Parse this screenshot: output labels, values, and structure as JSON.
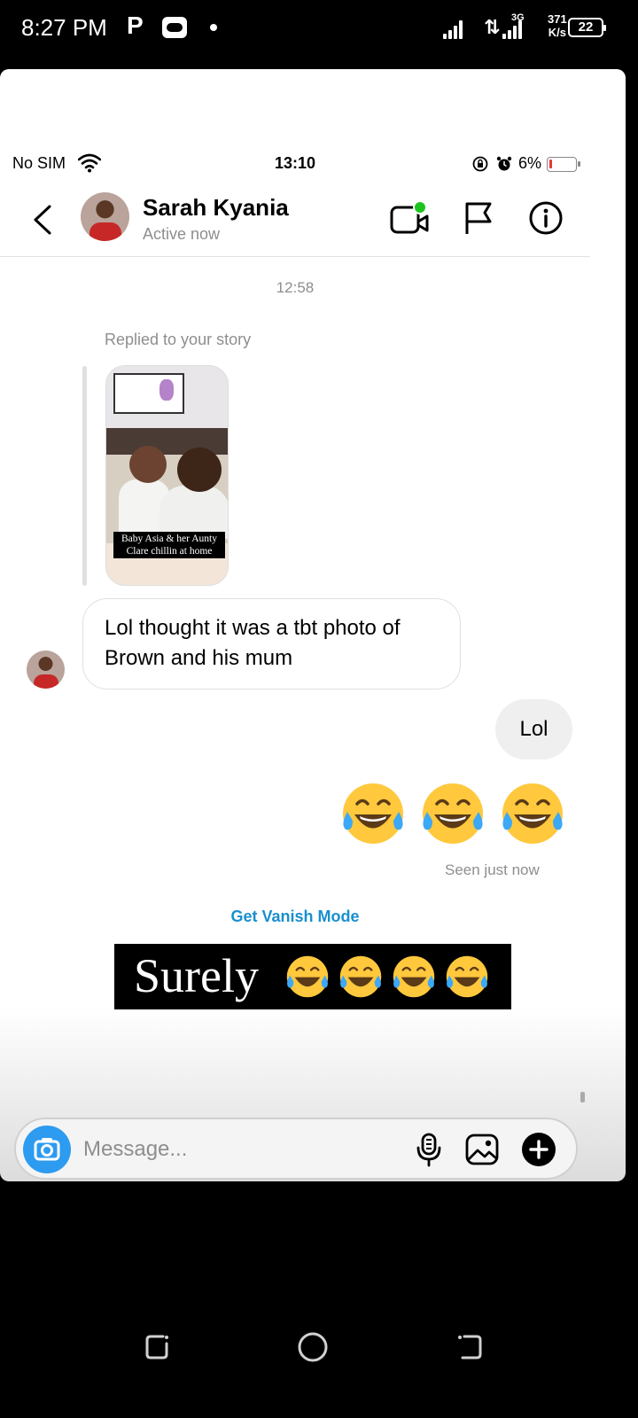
{
  "android_status": {
    "time": "8:27 PM",
    "app_badge_letter": "P",
    "network_type": "3G",
    "speed_value": "371",
    "speed_unit": "K/s",
    "battery": "22"
  },
  "ios_status": {
    "carrier": "No SIM",
    "time": "13:10",
    "battery_percent": "6%"
  },
  "header": {
    "contact_name": "Sarah Kyania",
    "contact_status": "Active now"
  },
  "thread": {
    "timestamp": "12:58",
    "reply_caption": "Replied to your story",
    "story_caption": "Baby Asia & her Aunty Clare chillin at home",
    "incoming_message": "Lol thought it was a tbt photo of Brown and his mum",
    "outgoing_message": "Lol",
    "outgoing_emojis": [
      "laugh-cry-emoji",
      "laugh-cry-emoji",
      "laugh-cry-emoji"
    ],
    "seen_status": "Seen just now",
    "vanish_mode_link": "Get Vanish Mode"
  },
  "overlay": {
    "caption": "Surely",
    "emojis": [
      "laugh-cry-emoji",
      "laugh-cry-emoji",
      "laugh-cry-emoji",
      "laugh-cry-emoji"
    ]
  },
  "composer": {
    "placeholder": "Message...",
    "value": ""
  },
  "colors": {
    "online_dot": "#1dc41d",
    "link_blue": "#1a8fcf",
    "camera_blue": "#2d9bf0",
    "battery_low": "#e53935"
  },
  "icons": [
    "back-icon",
    "video-call-icon",
    "flag-icon",
    "info-icon",
    "camera-icon",
    "microphone-icon",
    "gallery-icon",
    "plus-icon"
  ]
}
